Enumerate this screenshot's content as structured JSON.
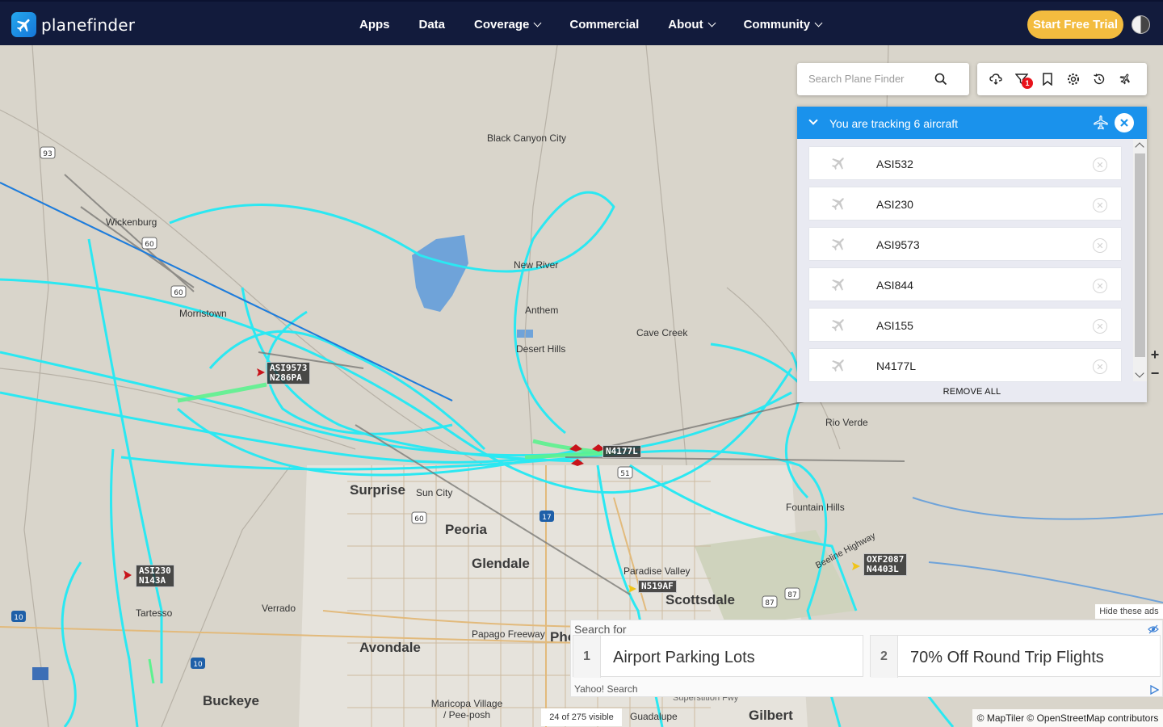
{
  "header": {
    "logo_text": "planefinder",
    "nav": [
      {
        "label": "Apps",
        "dropdown": false
      },
      {
        "label": "Data",
        "dropdown": false
      },
      {
        "label": "Coverage",
        "dropdown": true
      },
      {
        "label": "Commercial",
        "dropdown": false
      },
      {
        "label": "About",
        "dropdown": true
      },
      {
        "label": "Community",
        "dropdown": true
      }
    ],
    "trial_button": "Start Free Trial"
  },
  "search": {
    "placeholder": "Search Plane Finder"
  },
  "toolbar": {
    "icons": [
      "weather-icon",
      "filter-icon",
      "bookmark-icon",
      "settings-icon",
      "history-icon",
      "tracking-icon"
    ],
    "filter_badge": "1"
  },
  "tracking": {
    "title": "You are tracking 6 aircraft",
    "aircraft": [
      "ASI532",
      "ASI230",
      "ASI9573",
      "ASI844",
      "ASI155",
      "N4177L"
    ],
    "remove_all": "REMOVE ALL"
  },
  "map": {
    "cities": [
      {
        "name": "Black Canyon City",
        "size": "small"
      },
      {
        "name": "Wickenburg",
        "size": "small"
      },
      {
        "name": "New River",
        "size": "small"
      },
      {
        "name": "Anthem",
        "size": "small"
      },
      {
        "name": "Cave Creek",
        "size": "small"
      },
      {
        "name": "Desert Hills",
        "size": "small"
      },
      {
        "name": "Morristown",
        "size": "small"
      },
      {
        "name": "Rio Verde",
        "size": "small"
      },
      {
        "name": "Fountain Hills",
        "size": "small"
      },
      {
        "name": "Surprise",
        "size": "big"
      },
      {
        "name": "Sun City",
        "size": "small"
      },
      {
        "name": "Peoria",
        "size": "big"
      },
      {
        "name": "Glendale",
        "size": "big"
      },
      {
        "name": "Paradise Valley",
        "size": "small"
      },
      {
        "name": "Scottsdale",
        "size": "big"
      },
      {
        "name": "Verrado",
        "size": "small"
      },
      {
        "name": "Tartesso",
        "size": "small"
      },
      {
        "name": "Papago Freeway",
        "size": "small"
      },
      {
        "name": "Avondale",
        "size": "big"
      },
      {
        "name": "Phoenix",
        "size": "big"
      },
      {
        "name": "Buckeye",
        "size": "big"
      },
      {
        "name": "Maricopa Village / Pee-posh",
        "size": "small"
      },
      {
        "name": "Gilbert",
        "size": "big"
      },
      {
        "name": "Guadalupe",
        "size": "small"
      },
      {
        "name": "Superstition Fwy",
        "size": "small"
      },
      {
        "name": "Beeline Highway",
        "size": "small"
      }
    ],
    "route_shields": [
      "93",
      "60",
      "60",
      "17",
      "51",
      "60",
      "10",
      "10",
      "87",
      "87"
    ],
    "flight_labels": [
      {
        "callsign": "ASI9573",
        "reg": "N286PA"
      },
      {
        "callsign": "",
        "reg": "N4177L"
      },
      {
        "callsign": "ASI230",
        "reg": "N143A"
      },
      {
        "callsign": "",
        "reg": "N519AF"
      },
      {
        "callsign": "OXF2087",
        "reg": "N4403L"
      }
    ],
    "colors": {
      "track": "#2be8f2",
      "track_low": "#5cf28f",
      "plane": "#c8141b",
      "plane_alt": "#f0c419"
    }
  },
  "ad": {
    "hide_label": "Hide these ads",
    "search_for": "Search for",
    "items": [
      {
        "num": "1",
        "text": "Airport Parking Lots"
      },
      {
        "num": "2",
        "text": "70% Off Round Trip Flights"
      }
    ],
    "source": "Yahoo! Search"
  },
  "footer": {
    "visible_count": "24 of 275 visible",
    "attribution": "© MapTiler © OpenStreetMap contributors"
  }
}
